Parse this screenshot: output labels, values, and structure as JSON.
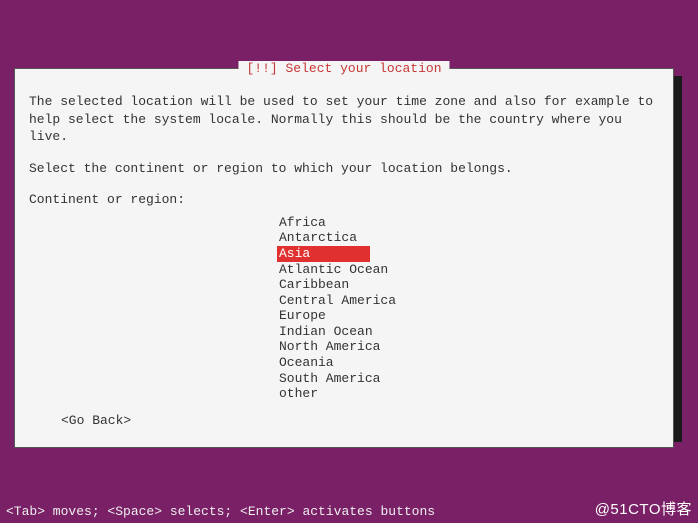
{
  "dialog": {
    "title": "[!!] Select your location",
    "paragraph1": "The selected location will be used to set your time zone and also for example to help select the system locale. Normally this should be the country where you live.",
    "paragraph2": "Select the continent or region to which your location belongs.",
    "prompt": "Continent or region:",
    "options": [
      "Africa",
      "Antarctica",
      "Asia",
      "Atlantic Ocean",
      "Caribbean",
      "Central America",
      "Europe",
      "Indian Ocean",
      "North America",
      "Oceania",
      "South America",
      "other"
    ],
    "selected_index": 2,
    "go_back": "<Go Back>"
  },
  "footer": {
    "help": "<Tab> moves; <Space> selects; <Enter> activates buttons"
  },
  "watermark": "@51CTO博客"
}
